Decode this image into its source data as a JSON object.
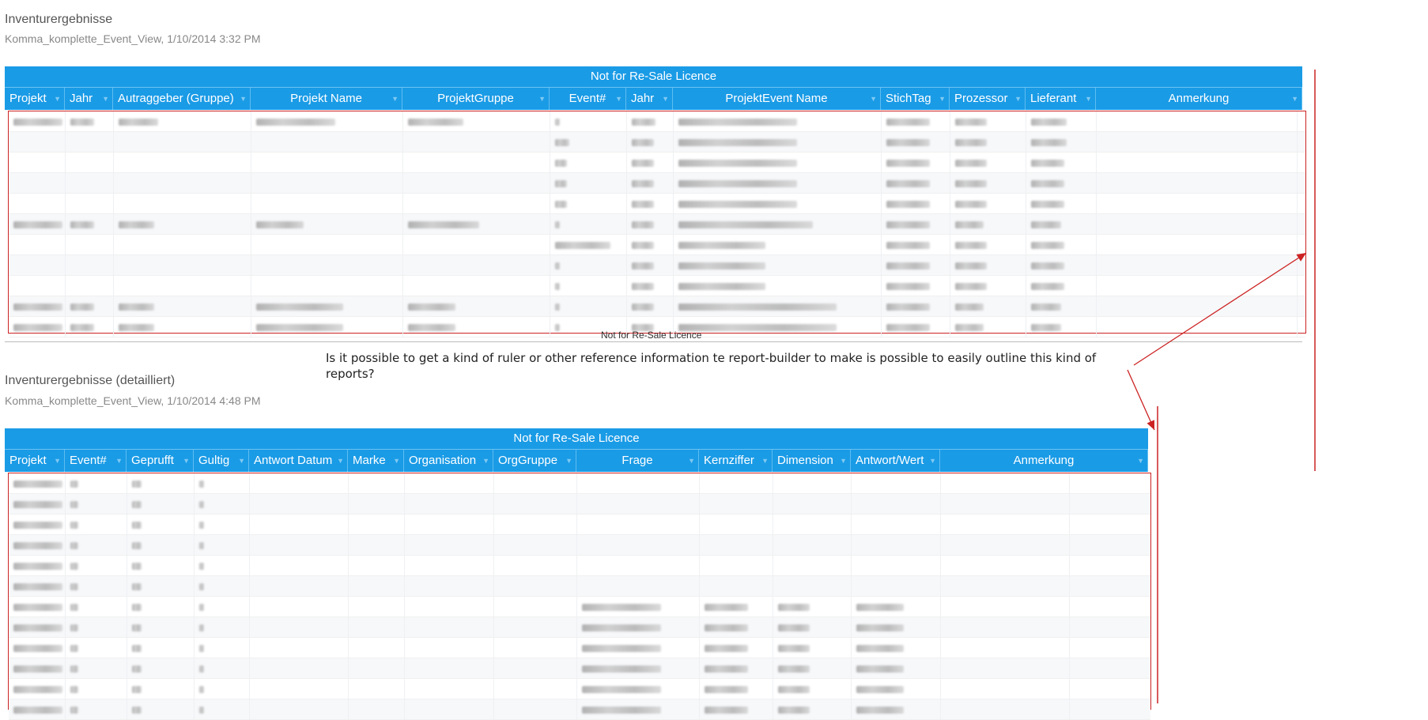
{
  "report1": {
    "title": "Inventurergebnisse",
    "subtitle": "Komma_komplette_Event_View, 1/10/2014 3:32 PM",
    "banner": "Not for Re-Sale Licence",
    "footer": "Not for Re-Sale Licence",
    "columns": [
      "Projekt",
      "Jahr",
      "Autraggeber (Gruppe)",
      "Projekt Name",
      "ProjektGruppe",
      "Event#",
      "Jahr",
      "ProjektEvent Name",
      "StichTag",
      "Prozessor",
      "Lieferant",
      "Anmerkung"
    ]
  },
  "report2": {
    "title": "Inventurergebnisse (detailliert)",
    "subtitle": "Komma_komplette_Event_View, 1/10/2014 4:48 PM",
    "banner": "Not for Re-Sale Licence",
    "columns": [
      "Projekt",
      "Event#",
      "Geprufft",
      "Gultig",
      "Antwort Datum",
      "Marke",
      "Organisation",
      "OrgGruppe",
      "Frage",
      "Kernziffer",
      "Dimension",
      "Antwort/Wert",
      "Anmerkung"
    ]
  },
  "comment": {
    "text": "Is it possible to get a kind of ruler or other reference information te report-builder to make is possible to easily outline this kind of reports?"
  },
  "colors": {
    "header": "#1a9be6",
    "annotation": "#cc2222"
  }
}
